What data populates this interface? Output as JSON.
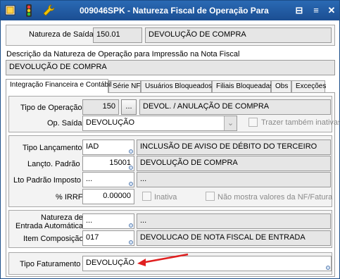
{
  "window": {
    "title": "009046SPK - Natureza Fiscal de Operação Para"
  },
  "header": {
    "natureza_label": "Natureza de Saída",
    "natureza_code": "150.01",
    "natureza_desc": "DEVOLUÇÃO DE COMPRA",
    "descricao_label": "Descrição da Natureza de Operação para Impressão na Nota Fiscal",
    "descricao_value": "DEVOLUÇÃO DE COMPRA"
  },
  "tabs": [
    {
      "label": "Integração Financeira e Contábil"
    },
    {
      "label": "Série NF"
    },
    {
      "label": "Usuários Bloqueados"
    },
    {
      "label": "Filiais Bloqueadas"
    },
    {
      "label": "Obs"
    },
    {
      "label": "Exceções"
    }
  ],
  "operacao": {
    "tipo_label": "Tipo de Operação",
    "tipo_code": "150",
    "ellipsis": "...",
    "tipo_desc": "DEVOL. / ANULAÇÃO DE COMPRA",
    "saida_label": "Op. Saída",
    "saida_value": "DEVOLUÇÃO",
    "trazer_label": "Trazer também inativas"
  },
  "lancamento": {
    "tipo_label": "Tipo Lançamento",
    "tipo_code": "IAD",
    "tipo_desc": "INCLUSÃO DE AVISO DE DÉBITO DO TERCEIRO",
    "padrao_label": "Lançto. Padrão",
    "padrao_code": "15001",
    "padrao_desc": "DEVOLUÇÃO DE COMPRA",
    "imposto_label": "Lto Padrão Imposto",
    "imposto_code": "...",
    "imposto_desc": "...",
    "irrf_label": "% IRRF",
    "irrf_value": "0.00000",
    "inativa_label": "Inativa",
    "nao_mostra_label": "Não mostra valores da NF/Fatura"
  },
  "entrada": {
    "natureza_label_1": "Natureza de",
    "natureza_label_2": "Entrada Automática",
    "natureza_code": "...",
    "natureza_desc": "...",
    "item_label": "Item Composição",
    "item_code": "017",
    "item_desc": "DEVOLUCAO DE NOTA FISCAL DE ENTRADA"
  },
  "faturamento": {
    "label": "Tipo Faturamento",
    "value": "DEVOLUÇÃO"
  },
  "colors": {
    "titlebar": "#1f5aa0",
    "arrow": "#e02020"
  }
}
